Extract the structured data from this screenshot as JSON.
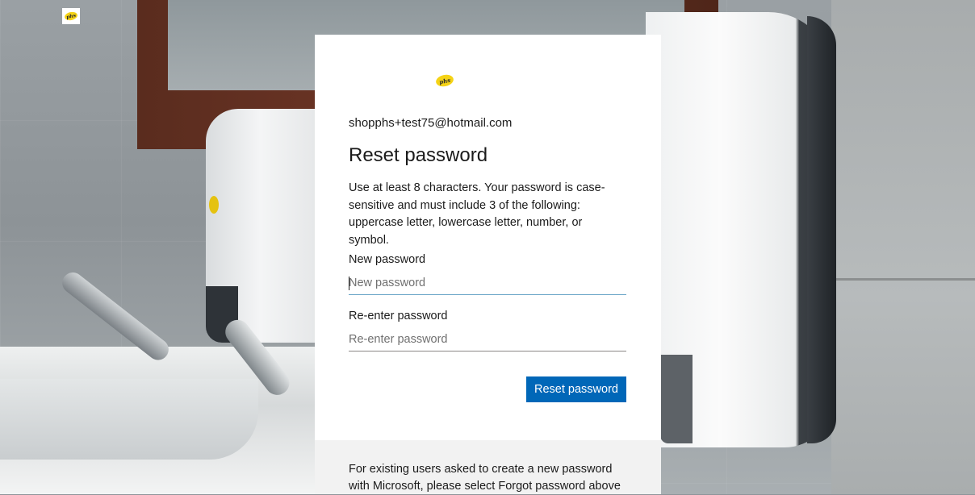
{
  "brand": {
    "logo_text": "phs",
    "logo_color": "#f5d316"
  },
  "background": {
    "description_icon": "washroom-photo"
  },
  "card": {
    "email": "shopphs+test75@hotmail.com",
    "title": "Reset password",
    "description": "Use at least 8 characters. Your password is case-sensitive and must include 3 of the following: uppercase letter, lowercase letter, number, or symbol.",
    "new_password": {
      "label": "New password",
      "placeholder": "New password",
      "value": ""
    },
    "reenter_password": {
      "label": "Re-enter password",
      "placeholder": "Re-enter password",
      "value": ""
    },
    "submit_label": "Reset password",
    "accent_color": "#0067b8",
    "footer_text": "For existing users asked to create a new password with Microsoft, please select Forgot password above"
  }
}
